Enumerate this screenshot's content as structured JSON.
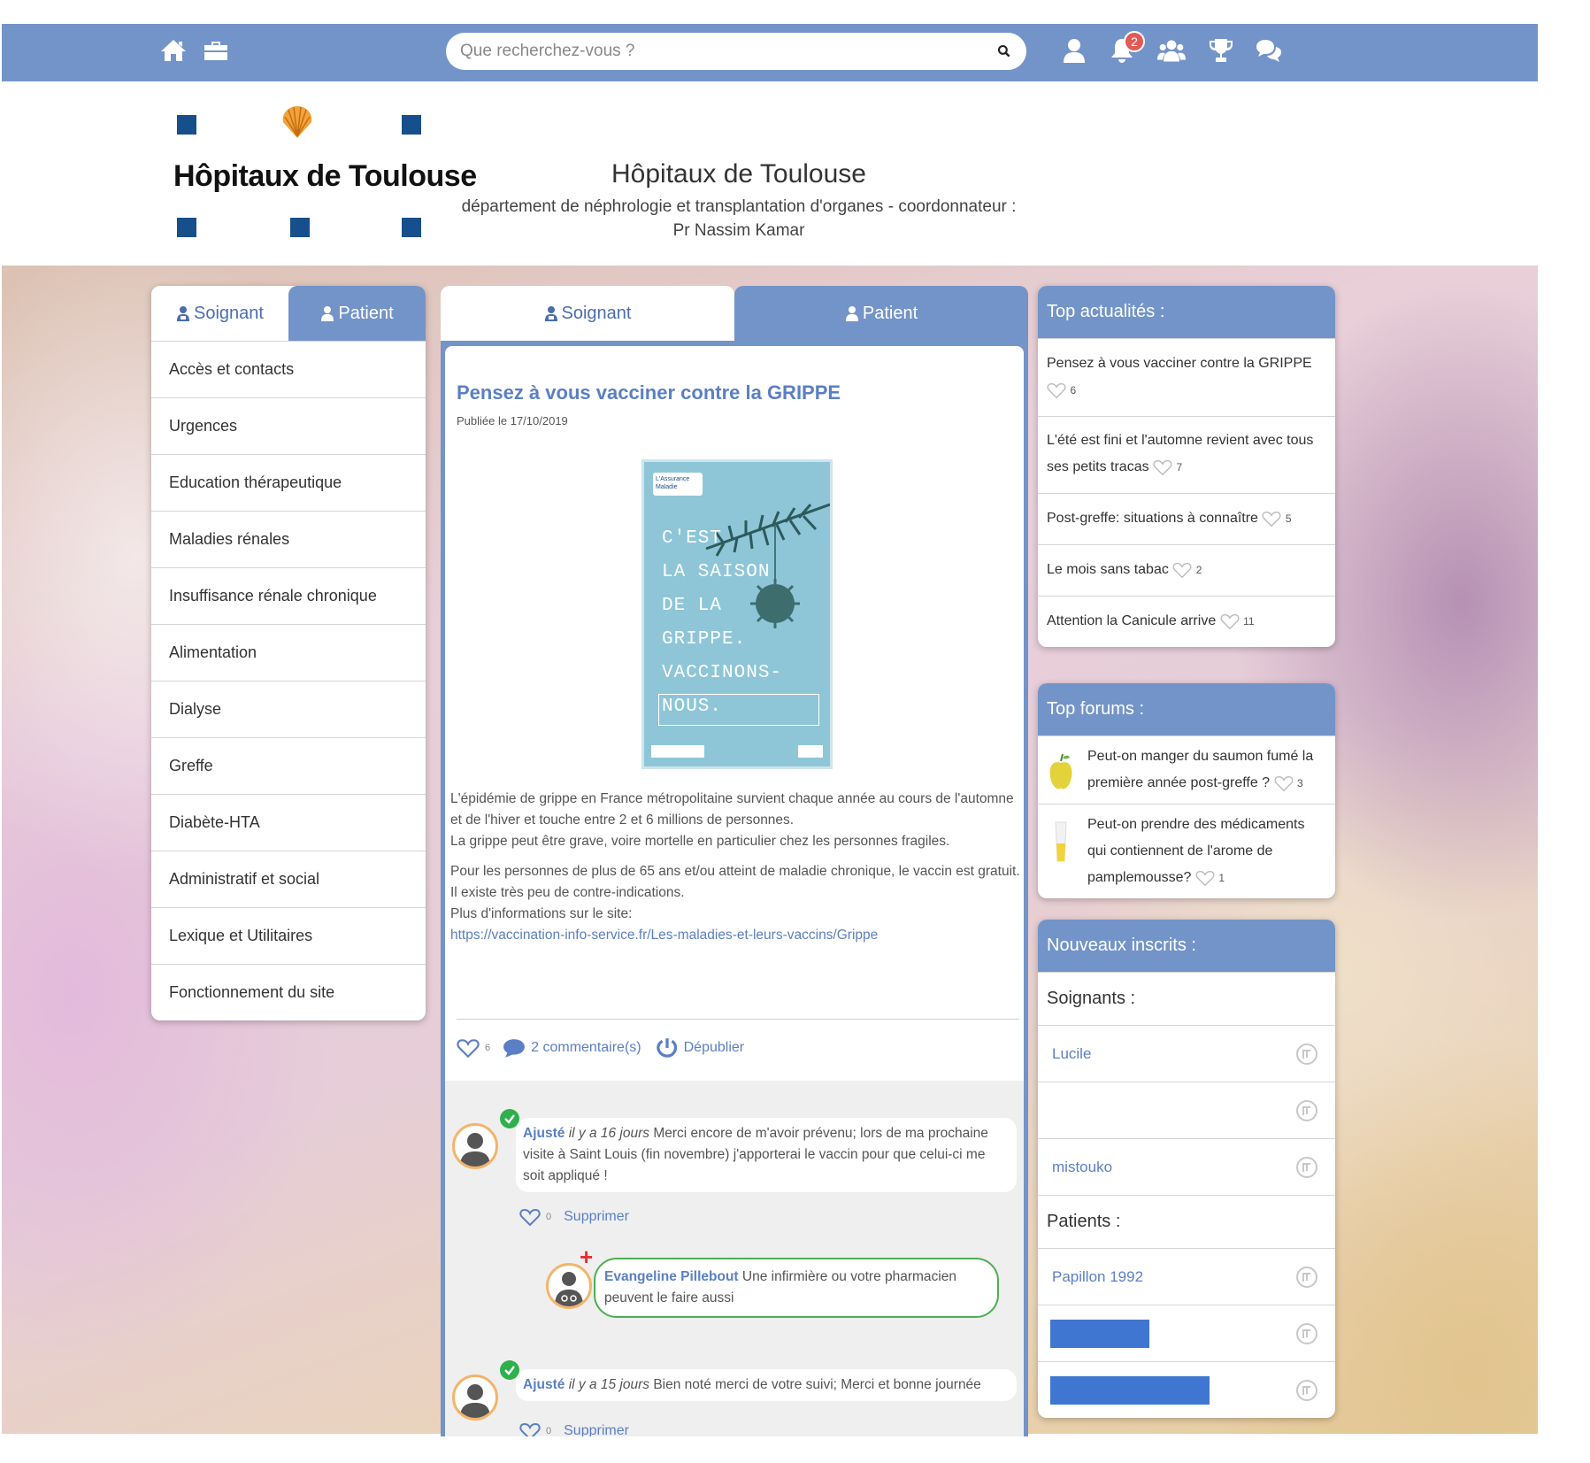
{
  "topbar": {
    "search_placeholder": "Que recherchez-vous ?",
    "notification_count": "2",
    "icons": [
      "home-icon",
      "briefcase-icon",
      "search-icon",
      "user-icon",
      "bell-icon",
      "users-icon",
      "trophy-icon",
      "chat-icon"
    ]
  },
  "header": {
    "logo_text": "Hôpitaux de Toulouse",
    "title": "Hôpitaux de Toulouse",
    "subtitle": "département de néphrologie et transplantation d'organes - coordonnateur : Pr Nassim Kamar"
  },
  "left_menu": {
    "tab_soignant": "Soignant",
    "tab_patient": "Patient",
    "items": [
      "Accès et contacts",
      "Urgences",
      "Education thérapeutique",
      "Maladies rénales",
      "Insuffisance rénale chronique",
      "Alimentation",
      "Dialyse",
      "Greffe",
      "Diabète-HTA",
      "Administratif et social",
      "Lexique et Utilitaires",
      "Fonctionnement du site"
    ]
  },
  "center": {
    "tab_soignant": "Soignant",
    "tab_patient": "Patient",
    "article": {
      "title": "Pensez à vous vacciner contre la GRIPPE",
      "date": "Publiée le 17/10/2019",
      "poster_lines": [
        "C'EST",
        "LA SAISON",
        "DE LA",
        "GRIPPE.",
        "VACCINONS-NOUS."
      ],
      "poster_brand": "L'Assurance Maladie",
      "p1_line1": "L'épidémie de grippe en France métropolitaine survient chaque année au cours de l'automne et de l'hiver et touche entre 2 et 6 millions de personnes.",
      "p1_line2": "La grippe peut être grave, voire mortelle en particulier chez les personnes fragiles.",
      "p2": "Pour les personnes de plus de 65 ans et/ou atteint de maladie chronique, le vaccin est gratuit. Il existe très peu de contre-indications.",
      "p3": "Plus d'informations sur le site:",
      "link": "https://vaccination-info-service.fr/Les-maladies-et-leurs-vaccins/Grippe",
      "likes": "6",
      "comments_label": "2 commentaire(s)",
      "unpublish_label": "Dépublier"
    },
    "comments": [
      {
        "author": "Ajusté",
        "when": "il y a 16 jours",
        "text": "Merci encore de m'avoir prévenu; lors de ma prochaine visite à Saint Louis (fin novembre) j'apporterai le vaccin pour que celui-ci me soit appliqué !",
        "likes": "0",
        "delete_label": "Supprimer"
      },
      {
        "author": "Evangeline Pillebout",
        "text": "Une infirmière ou votre pharmacien peuvent le faire aussi"
      },
      {
        "author": "Ajusté",
        "when": "il y a 15 jours",
        "text": "Bien noté merci de votre suivi; Merci et bonne journée",
        "likes": "0",
        "delete_label": "Supprimer"
      }
    ]
  },
  "top_news": {
    "title": "Top actualités :",
    "items": [
      {
        "label": "Pensez à vous vacciner contre la GRIPPE",
        "likes": "6"
      },
      {
        "label": "L'été est fini et l'automne revient avec tous ses petits tracas",
        "likes": "7"
      },
      {
        "label": "Post-greffe: situations à connaître",
        "likes": "5"
      },
      {
        "label": "Le mois sans tabac",
        "likes": "2"
      },
      {
        "label": "Attention la Canicule arrive",
        "likes": "11"
      }
    ]
  },
  "top_forums": {
    "title": "Top forums :",
    "items": [
      {
        "label": "Peut-on manger du saumon fumé la première année post-greffe ?",
        "likes": "3"
      },
      {
        "label": "Peut-on prendre des médicaments qui contiennent de l'arome de pamplemousse?",
        "likes": "1"
      }
    ]
  },
  "new_members": {
    "title": "Nouveaux inscrits :",
    "soignants_label": "Soignants :",
    "soignants": [
      "Lucile",
      "",
      "mistouko"
    ],
    "patients_label": "Patients :",
    "patients": [
      "Papillon 1992",
      "",
      ""
    ]
  },
  "colors": {
    "primary": "#7394c8",
    "link": "#5b7fc4",
    "logo_blue": "#174f8c",
    "check_green": "#2eb04c"
  }
}
